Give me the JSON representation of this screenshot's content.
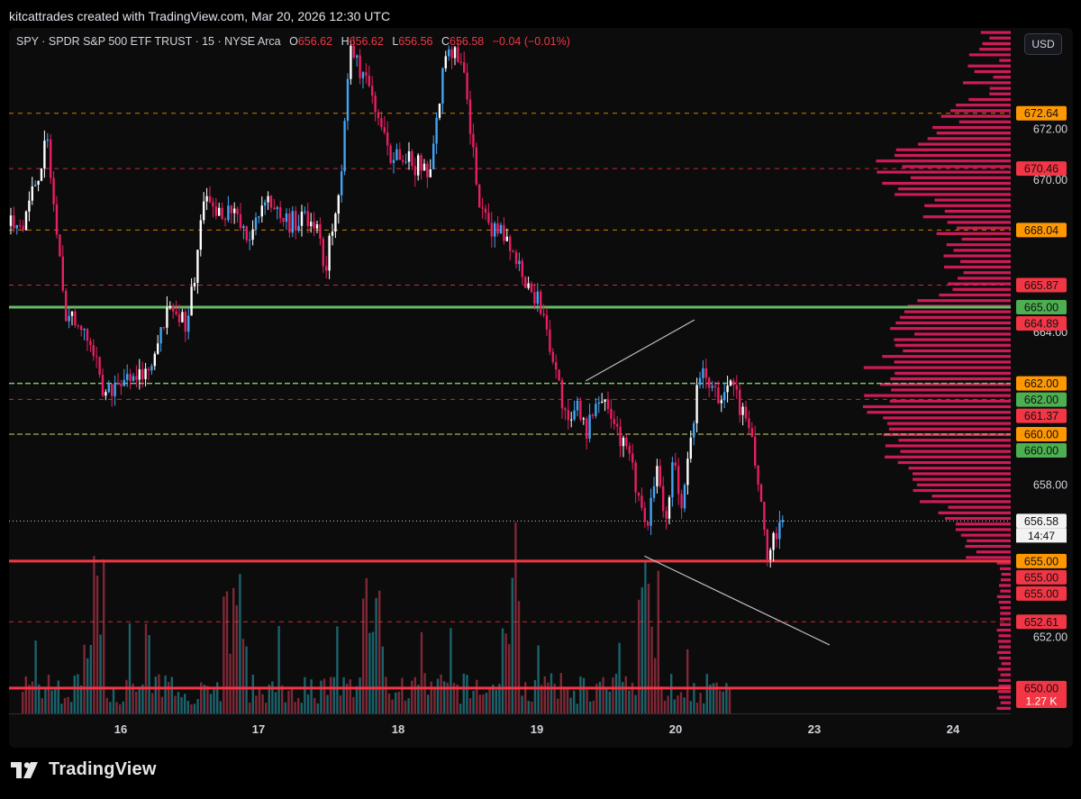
{
  "attribution": "kitcattrades created with TradingView.com, Mar 20, 2026 12:30 UTC",
  "legend": {
    "symbol": "SPY · SPDR S&P 500 ETF TRUST · 15 · NYSE Arca",
    "open_label": "O",
    "open": "656.62",
    "high_label": "H",
    "high": "656.62",
    "low_label": "L",
    "low": "656.56",
    "close_label": "C",
    "close": "656.58",
    "change": "−0.04 (−0.01%)"
  },
  "currency_button": "USD",
  "brand": "TradingView",
  "colors": {
    "up": "#42a5f5",
    "down": "#e91e63",
    "bull_wick": "#ffffff",
    "support_line": "#f23645",
    "green_line": "#4caf50",
    "volume_profile": "#e91e63",
    "background": "#0c0c0c"
  },
  "chart_data": {
    "type": "candlestick",
    "symbol": "SPY",
    "interval": "15",
    "ylim": [
      649.0,
      676.0
    ],
    "y_ticks": [
      "672.00",
      "670.00",
      "664.00",
      "658.00",
      "652.00"
    ],
    "x_ticks": [
      {
        "label": "16",
        "x": "Mar 16"
      },
      {
        "label": "17",
        "x": "Mar 17"
      },
      {
        "label": "18",
        "x": "Mar 18"
      },
      {
        "label": "19",
        "x": "Mar 19"
      },
      {
        "label": "20",
        "x": "Mar 20"
      },
      {
        "label": "23",
        "x": "Mar 23"
      },
      {
        "label": "24",
        "x": "Mar 24"
      }
    ],
    "price_path": [
      [
        "Mar 13 14:00",
        668.2
      ],
      [
        "Mar 13 15:30",
        671.5
      ],
      [
        "Mar 13 16:30",
        665.0
      ],
      [
        "Mar 16 09:30",
        663.2
      ],
      [
        "Mar 16 10:00",
        661.5
      ],
      [
        "Mar 16 11:00",
        661.9
      ],
      [
        "Mar 16 13:00",
        662.5
      ],
      [
        "Mar 16 14:00",
        665.5
      ],
      [
        "Mar 16 15:00",
        664.0
      ],
      [
        "Mar 16 16:00",
        669.0
      ],
      [
        "Mar 17 09:30",
        668.8
      ],
      [
        "Mar 17 10:30",
        667.5
      ],
      [
        "Mar 17 11:30",
        669.5
      ],
      [
        "Mar 17 12:30",
        668.3
      ],
      [
        "Mar 17 14:30",
        668.5
      ],
      [
        "Mar 17 15:00",
        666.0
      ],
      [
        "Mar 17 15:30",
        668.5
      ],
      [
        "Mar 17 16:00",
        670.5
      ],
      [
        "Mar 17 16:30",
        675.0
      ],
      [
        "Mar 18 09:30",
        673.5
      ],
      [
        "Mar 18 10:30",
        671.0
      ],
      [
        "Mar 18 11:30",
        670.8
      ],
      [
        "Mar 18 13:00",
        670.3
      ],
      [
        "Mar 18 14:00",
        675.5
      ],
      [
        "Mar 18 15:00",
        674.0
      ],
      [
        "Mar 18 16:00",
        668.5
      ],
      [
        "Mar 19 09:30",
        667.5
      ],
      [
        "Mar 19 10:30",
        666.0
      ],
      [
        "Mar 19 11:30",
        664.8
      ],
      [
        "Mar 19 13:00",
        660.0
      ],
      [
        "Mar 19 13:30",
        661.5
      ],
      [
        "Mar 19 14:00",
        660.0
      ],
      [
        "Mar 19 15:00",
        661.8
      ],
      [
        "Mar 19 16:00",
        660.0
      ],
      [
        "Mar 20 09:30",
        656.5
      ],
      [
        "Mar 20 10:00",
        659.0
      ],
      [
        "Mar 20 10:30",
        656.5
      ],
      [
        "Mar 20 11:00",
        659.0
      ],
      [
        "Mar 20 11:30",
        657.0
      ],
      [
        "Mar 20 12:30",
        662.5
      ],
      [
        "Mar 20 13:30",
        661.5
      ],
      [
        "Mar 20 14:30",
        661.8
      ],
      [
        "Mar 20 15:30",
        660.0
      ],
      [
        "Mar 20 16:00",
        658.0
      ],
      [
        "Mar 20 16:30",
        655.0
      ],
      [
        "Mar 20 17:00",
        656.0
      ],
      [
        "Mar 20 17:30",
        656.6
      ]
    ],
    "horizontal_levels": [
      {
        "price": 672.64,
        "style": "dashed",
        "color": "#ff9800",
        "label": "672.64"
      },
      {
        "price": 670.46,
        "style": "dashed",
        "color": "#f23645",
        "label": "670.46"
      },
      {
        "price": 668.04,
        "style": "dashed",
        "color": "#ff9800",
        "label": "668.04"
      },
      {
        "price": 665.87,
        "style": "dashed",
        "color": "#f23645",
        "label": "665.87"
      },
      {
        "price": 665.0,
        "style": "solid",
        "color": "#4caf50",
        "label": "665.00"
      },
      {
        "price": 664.89,
        "style": "none",
        "color": "#f23645",
        "label": "664.89"
      },
      {
        "price": 662.0,
        "style": "none",
        "color": "#ff9800",
        "label": "662.00"
      },
      {
        "price": 662.0,
        "style": "dashed-green",
        "color": "#4caf50",
        "label": "662.00"
      },
      {
        "price": 661.37,
        "style": "dashed",
        "color": "#f23645",
        "label": "661.37"
      },
      {
        "price": 660.0,
        "style": "none",
        "color": "#ff9800",
        "label": "660.00"
      },
      {
        "price": 660.0,
        "style": "dashed-yellow",
        "color": "#4caf50",
        "label": "660.00"
      },
      {
        "price": 656.58,
        "style": "dotted",
        "color": "#ffffff",
        "label": "656.58"
      },
      {
        "price": 655.0,
        "style": "solid",
        "color": "#ff9800",
        "label": "655.00"
      },
      {
        "price": 655.0,
        "style": "none",
        "color": "#f23645",
        "label": "655.00"
      },
      {
        "price": 655.0,
        "style": "none",
        "color": "#f23645",
        "label": "655.00"
      },
      {
        "price": 652.61,
        "style": "dashed",
        "color": "#f23645",
        "label": "652.61"
      },
      {
        "price": 650.0,
        "style": "solid",
        "color": "#f23645",
        "label": "650.00"
      }
    ],
    "countdown": "14:47",
    "volume_label": "1.27 K",
    "trendlines": [
      {
        "from": [
          "Mar 19 14:00",
          662.1
        ],
        "to": [
          "Mar 23 04:00",
          664.5
        ]
      },
      {
        "from": [
          "Mar 20 09:15",
          655.2
        ],
        "to": [
          "Mar 23 12:00",
          651.7
        ]
      }
    ]
  }
}
